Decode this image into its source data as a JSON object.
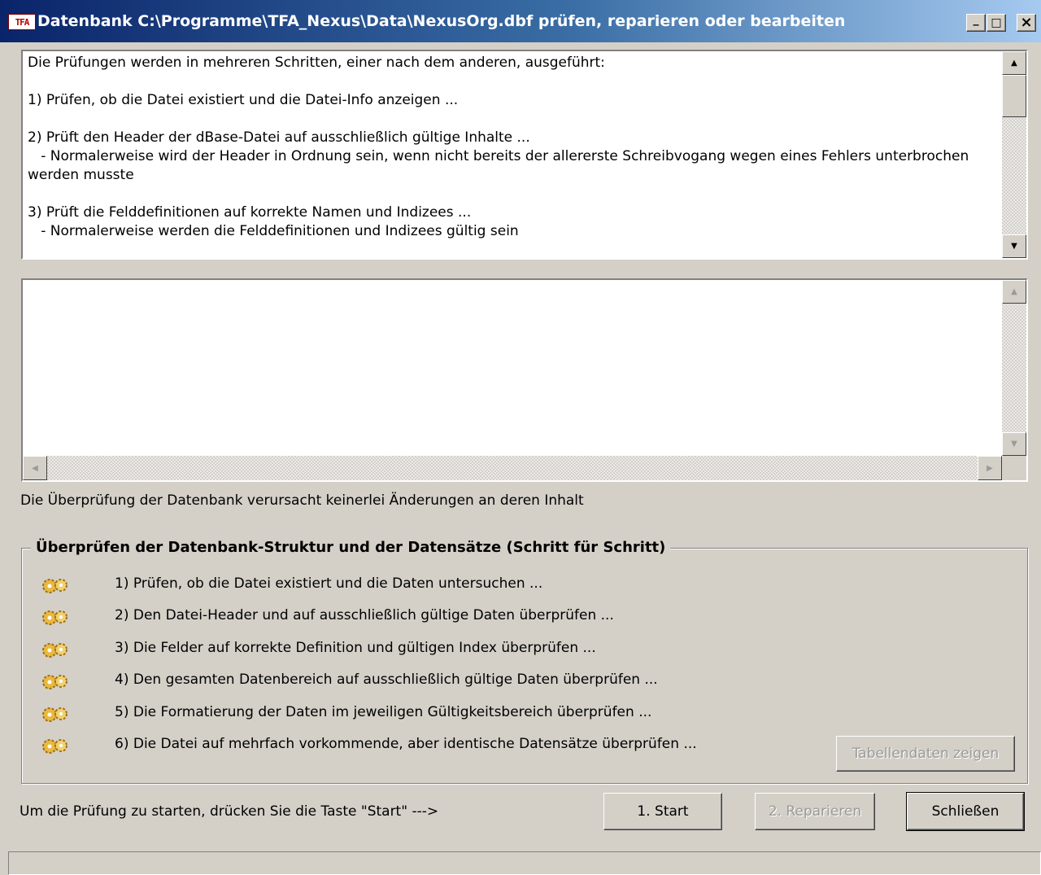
{
  "window": {
    "app_icon_text": "TFA",
    "title": "Datenbank C:\\Programme\\TFA_Nexus\\Data\\NexusOrg.dbf prüfen, reparieren oder bearbeiten",
    "minimize_glyph": "_",
    "maximize_glyph": "□",
    "close_glyph": "×"
  },
  "info_box": {
    "text": "Die Prüfungen werden in mehreren Schritten, einer nach dem anderen, ausgeführt:\n\n1) Prüfen, ob die Datei existiert und die Datei-Info anzeigen ...\n\n2) Prüft den Header der dBase-Datei auf ausschließlich gültige Inhalte ...\n   - Normalerweise wird der Header in Ordnung sein, wenn nicht bereits der allererste Schreibvogang wegen eines Fehlers unterbrochen werden musste\n\n3) Prüft die Felddefinitionen auf korrekte Namen und Indizees ...\n   - Normalerweise werden die Felddefinitionen und Indizees gültig sein"
  },
  "output_box": {
    "text": ""
  },
  "note": "Die Überprüfung der Datenbank verursacht keinerlei Änderungen an deren Inhalt",
  "group": {
    "title": "Überprüfen der Datenbank-Struktur und der Datensätze (Schritt für Schritt)",
    "steps": [
      {
        "label": "1) Prüfen, ob die Datei existiert und die Daten untersuchen ...",
        "icon": "gears-icon"
      },
      {
        "label": "2) Den Datei-Header und auf ausschließlich gültige Daten überprüfen ...",
        "icon": "gears-icon"
      },
      {
        "label": "3) Die Felder auf korrekte Definition und gültigen Index überprüfen ...",
        "icon": "gears-icon"
      },
      {
        "label": "4) Den gesamten Datenbereich auf ausschließlich gültige Daten überprüfen ...",
        "icon": "gears-icon"
      },
      {
        "label": "5) Die Formatierung der Daten im jeweiligen Gültigkeitsbereich überprüfen ...",
        "icon": "gears-icon"
      },
      {
        "label": "6) Die Datei auf mehrfach vorkommende, aber identische Datensätze überprüfen ...",
        "icon": "gears-icon"
      }
    ],
    "show_table_button": "Tabellendaten zeigen"
  },
  "footer": {
    "hint": "Um die Prüfung zu starten, drücken Sie die Taste \"Start\" --->",
    "start_button": "1. Start",
    "repair_button": "2. Reparieren",
    "close_button": "Schließen"
  },
  "status_bar": {
    "text": ""
  }
}
